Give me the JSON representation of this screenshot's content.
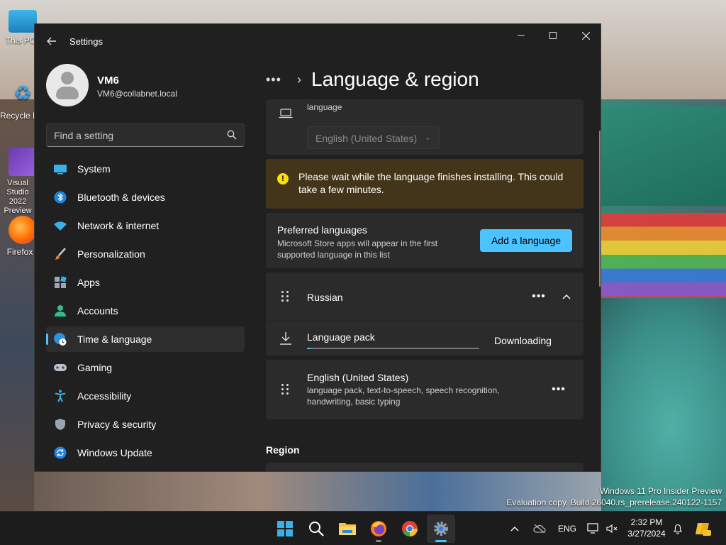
{
  "desktop": {
    "icons": [
      {
        "label": "This PC"
      },
      {
        "label": "Recycle Bin"
      },
      {
        "label": "Visual Studio 2022 Preview"
      },
      {
        "label": "Firefox"
      }
    ],
    "watermark_line1": "Windows 11 Pro Insider Preview",
    "watermark_line2": "Evaluation copy. Build 26040.rs_prerelease.240122-1157"
  },
  "window": {
    "title": "Settings",
    "back_icon": "arrow-left-icon",
    "controls": {
      "minimize": "minimize-icon",
      "maximize": "maximize-icon",
      "close": "close-icon"
    }
  },
  "profile": {
    "name": "VM6",
    "email": "VM6@collabnet.local"
  },
  "search": {
    "placeholder": "Find a setting"
  },
  "nav": {
    "items": [
      {
        "label": "System",
        "icon": "monitor-icon"
      },
      {
        "label": "Bluetooth & devices",
        "icon": "bluetooth-icon"
      },
      {
        "label": "Network & internet",
        "icon": "wifi-icon"
      },
      {
        "label": "Personalization",
        "icon": "brush-icon"
      },
      {
        "label": "Apps",
        "icon": "apps-icon"
      },
      {
        "label": "Accounts",
        "icon": "person-icon"
      },
      {
        "label": "Time & language",
        "icon": "globe-clock-icon",
        "selected": true
      },
      {
        "label": "Gaming",
        "icon": "gamepad-icon"
      },
      {
        "label": "Accessibility",
        "icon": "accessibility-icon"
      },
      {
        "label": "Privacy & security",
        "icon": "shield-icon"
      },
      {
        "label": "Windows Update",
        "icon": "update-icon"
      }
    ]
  },
  "main": {
    "breadcrumb_more": "•••",
    "page_title": "Language & region",
    "display_language": {
      "desc": "language",
      "selected": "English (United States)"
    },
    "warning": {
      "text": "Please wait while the language finishes installing. This could take a few minutes."
    },
    "preferred": {
      "title": "Preferred languages",
      "desc": "Microsoft Store apps will appear in the first supported language in this list",
      "add_button": "Add a language"
    },
    "languages": [
      {
        "name": "Russian",
        "more": "•••",
        "pack_label": "Language pack",
        "pack_status": "Downloading",
        "progress": 0.02
      },
      {
        "name": "English (United States)",
        "desc": "language pack, text-to-speech, speech recognition, handwriting, basic typing",
        "more": "•••"
      }
    ],
    "region_heading": "Region"
  },
  "taskbar": {
    "apps": [
      {
        "name": "start",
        "icon": "windows-logo-icon"
      },
      {
        "name": "search",
        "icon": "search-icon"
      },
      {
        "name": "file-explorer",
        "icon": "folder-icon"
      },
      {
        "name": "firefox",
        "icon": "firefox-icon"
      },
      {
        "name": "chrome",
        "icon": "chrome-icon"
      },
      {
        "name": "settings",
        "icon": "gear-icon",
        "active": true
      }
    ],
    "lang": "ENG",
    "time": "2:32 PM",
    "date": "3/27/2024"
  },
  "colors": {
    "accent": "#4cc2ff",
    "window_bg": "#202020",
    "card_bg": "#2b2b2b",
    "warning_bg": "#433519",
    "warning_icon": "#fce100"
  }
}
